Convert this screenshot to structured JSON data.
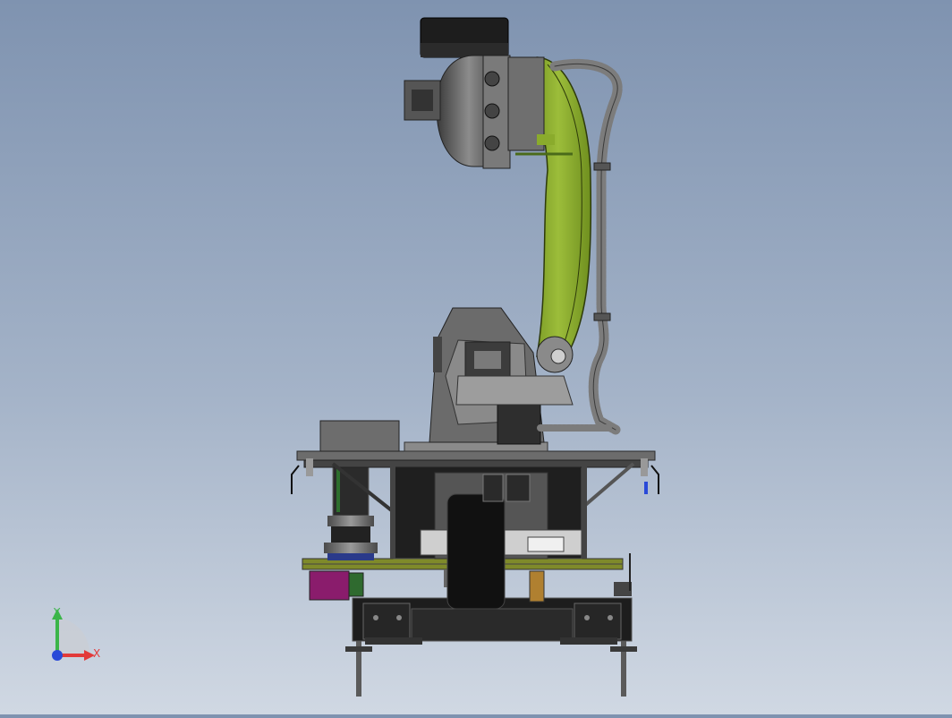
{
  "viewport": {
    "colors": {
      "bg_top": "#7f93b0",
      "bg_bottom": "#d0d8e3",
      "arm_green": "#8aab2c",
      "dark_gray": "#3c3c3c",
      "mid_gray": "#7a7a7a",
      "frame_olive": "#7f8a2a",
      "motor_purple": "#8a1c6c"
    },
    "model_icon": "industrial-robot-on-agv-model"
  },
  "triad": {
    "x_label": "X",
    "y_label": "Y",
    "colors": {
      "x": "#e23a3a",
      "y": "#3bb54a",
      "z": "#2a4ad8"
    }
  }
}
